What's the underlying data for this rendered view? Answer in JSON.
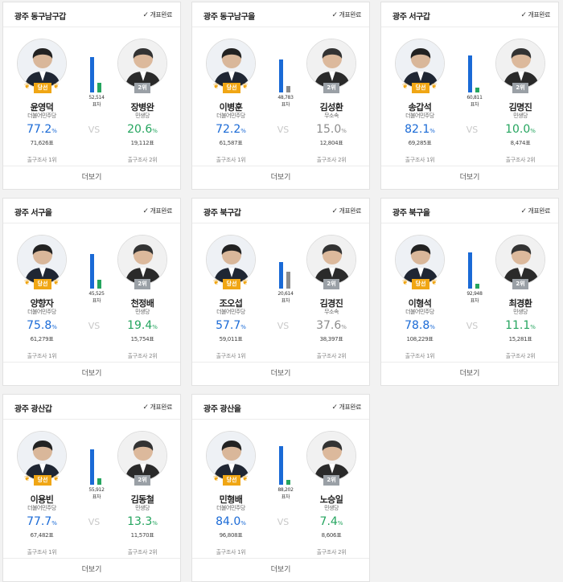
{
  "labels": {
    "status": "개표완료",
    "more": "더보기",
    "vs": "VS",
    "win_badge": "당선",
    "second_badge": "2위",
    "margin_unit": "표차",
    "pct_unit": "%",
    "exit_left": "출구조사 1위",
    "exit_right": "출구조사 2위"
  },
  "colors": {
    "winner_blue": "#1a6ad6",
    "minsaeng_green": "#25a55f",
    "independent_gray": "#8d8d8d",
    "win_gold": "#f0a614"
  },
  "districts": [
    {
      "name": "광주 동구남구갑",
      "margin": "52,514",
      "left": {
        "name": "윤영덕",
        "party": "더불어민주당",
        "pct": "77.2",
        "votes": "71,626표"
      },
      "right": {
        "name": "장병완",
        "party": "민생당",
        "pct": "20.6",
        "votes": "19,112표",
        "color": "#25a55f"
      }
    },
    {
      "name": "광주 동구남구을",
      "margin": "48,783",
      "left": {
        "name": "이병훈",
        "party": "더불어민주당",
        "pct": "72.2",
        "votes": "61,587표"
      },
      "right": {
        "name": "김성환",
        "party": "무소속",
        "pct": "15.0",
        "votes": "12,804표",
        "color": "#8d8d8d"
      }
    },
    {
      "name": "광주 서구갑",
      "margin": "60,811",
      "left": {
        "name": "송갑석",
        "party": "더불어민주당",
        "pct": "82.1",
        "votes": "69,285표"
      },
      "right": {
        "name": "김명진",
        "party": "민생당",
        "pct": "10.0",
        "votes": "8,474표",
        "color": "#25a55f"
      }
    },
    {
      "name": "광주 서구을",
      "margin": "45,525",
      "left": {
        "name": "양향자",
        "party": "더불어민주당",
        "pct": "75.8",
        "votes": "61,279표"
      },
      "right": {
        "name": "천정배",
        "party": "민생당",
        "pct": "19.4",
        "votes": "15,754표",
        "color": "#25a55f"
      }
    },
    {
      "name": "광주 북구갑",
      "margin": "20,614",
      "left": {
        "name": "조오섭",
        "party": "더불어민주당",
        "pct": "57.7",
        "votes": "59,011표"
      },
      "right": {
        "name": "김경진",
        "party": "무소속",
        "pct": "37.6",
        "votes": "38,397표",
        "color": "#8d8d8d"
      }
    },
    {
      "name": "광주 북구을",
      "margin": "92,948",
      "left": {
        "name": "이형석",
        "party": "더불어민주당",
        "pct": "78.8",
        "votes": "108,229표"
      },
      "right": {
        "name": "최경환",
        "party": "민생당",
        "pct": "11.1",
        "votes": "15,281표",
        "color": "#25a55f"
      }
    },
    {
      "name": "광주 광산갑",
      "margin": "55,912",
      "left": {
        "name": "이용빈",
        "party": "더불어민주당",
        "pct": "77.7",
        "votes": "67,482표"
      },
      "right": {
        "name": "김동철",
        "party": "민생당",
        "pct": "13.3",
        "votes": "11,570표",
        "color": "#25a55f"
      }
    },
    {
      "name": "광주 광산을",
      "margin": "88,202",
      "left": {
        "name": "민형배",
        "party": "더불어민주당",
        "pct": "84.0",
        "votes": "96,808표"
      },
      "right": {
        "name": "노승일",
        "party": "민생당",
        "pct": "7.4",
        "votes": "8,606표",
        "color": "#25a55f"
      }
    }
  ]
}
